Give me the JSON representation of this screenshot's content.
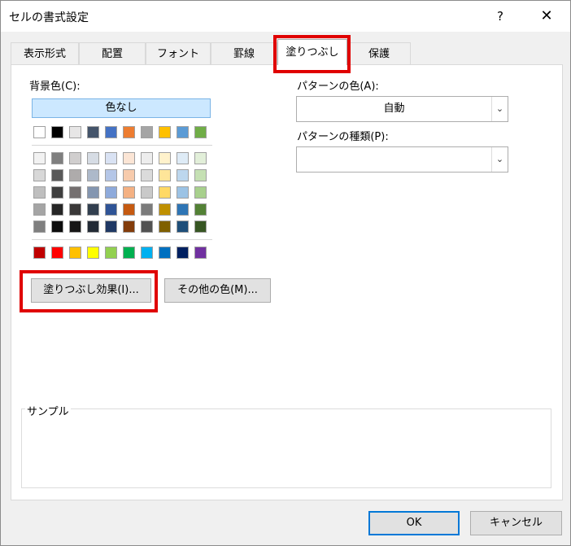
{
  "window": {
    "title": "セルの書式設定",
    "help": "?",
    "close": "✕"
  },
  "tabs": [
    {
      "label": "表示形式"
    },
    {
      "label": "配置"
    },
    {
      "label": "フォント"
    },
    {
      "label": "罫線"
    },
    {
      "label": "塗りつぶし",
      "active": true
    },
    {
      "label": "保護"
    }
  ],
  "fill": {
    "background_label": "背景色(C):",
    "no_color": "色なし",
    "fill_effects": "塗りつぶし効果(I)...",
    "more_colors": "その他の色(M)...",
    "palette_top": [
      "#ffffff",
      "#000000",
      "#e7e6e6",
      "#44546a",
      "#4472c4",
      "#ed7d31",
      "#a5a5a5",
      "#ffc000",
      "#5b9bd5",
      "#70ad47"
    ],
    "palette_shades": [
      [
        "#f2f2f2",
        "#7f7f7f",
        "#d0cece",
        "#d6dce4",
        "#d9e2f3",
        "#fbe5d5",
        "#ededed",
        "#fff2cc",
        "#deebf6",
        "#e2efd9"
      ],
      [
        "#d8d8d8",
        "#595959",
        "#aeabab",
        "#adb9ca",
        "#b4c6e7",
        "#f7cbac",
        "#dbdbdb",
        "#fee599",
        "#bdd7ee",
        "#c5e0b3"
      ],
      [
        "#bfbfbf",
        "#3f3f3f",
        "#757070",
        "#8496b0",
        "#8eaadb",
        "#f4b183",
        "#c9c9c9",
        "#ffd965",
        "#9cc3e5",
        "#a8d08d"
      ],
      [
        "#a5a5a5",
        "#262626",
        "#3a3838",
        "#323f4f",
        "#2f5496",
        "#c55a11",
        "#7b7b7b",
        "#bf9000",
        "#2e75b5",
        "#538135"
      ],
      [
        "#7f7f7f",
        "#0c0c0c",
        "#171616",
        "#222a35",
        "#1f3864",
        "#833c0b",
        "#525252",
        "#7f6000",
        "#1e4e79",
        "#375623"
      ]
    ],
    "palette_standard": [
      "#c00000",
      "#ff0000",
      "#ffc000",
      "#ffff00",
      "#92d050",
      "#00b050",
      "#00b0f0",
      "#0070c0",
      "#002060",
      "#7030a0"
    ]
  },
  "pattern": {
    "color_label": "パターンの色(A):",
    "color_value": "自動",
    "style_label": "パターンの種類(P):",
    "style_value": ""
  },
  "sample": {
    "label": "サンプル"
  },
  "footer": {
    "ok": "OK",
    "cancel": "キャンセル"
  },
  "highlight_color": "#e00000"
}
